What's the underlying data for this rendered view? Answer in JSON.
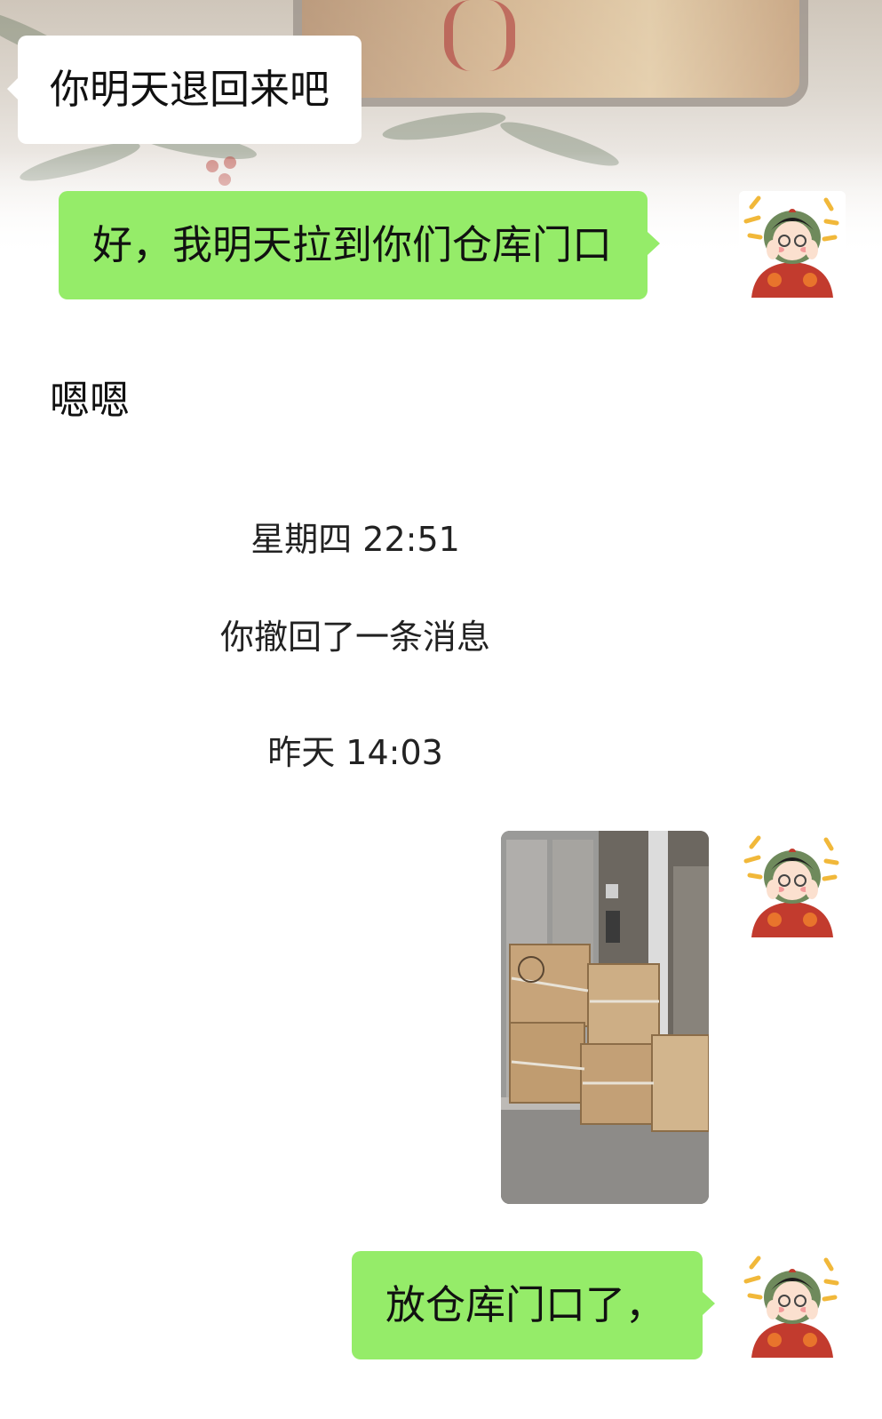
{
  "messages": {
    "m1": {
      "sender": "contact",
      "text": "你明天退回来吧"
    },
    "m2": {
      "sender": "me",
      "text": "好，我明天拉到你们仓库门口"
    },
    "m3": {
      "sender": "contact",
      "text": "嗯嗯"
    },
    "time1": "星期四 22:51",
    "recall": "你撤回了一条消息",
    "time2": "昨天 14:03",
    "m4": {
      "sender": "me",
      "type": "image",
      "content": "photo of cardboard boxes at warehouse door"
    },
    "m5": {
      "sender": "me",
      "text": "放仓库门口了，"
    }
  },
  "colors": {
    "outgoing_bubble": "#95ec69",
    "incoming_bubble": "#ffffff",
    "background": "#ffffff"
  },
  "icons": {
    "avatar": "cartoon-girl-avatar-icon"
  }
}
